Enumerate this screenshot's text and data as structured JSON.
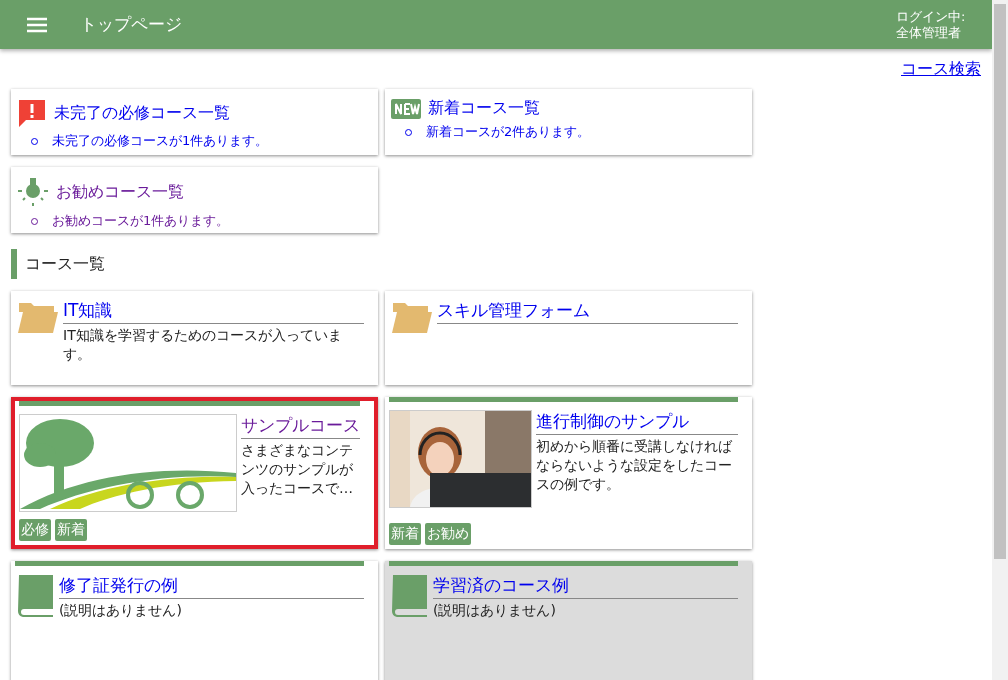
{
  "header": {
    "title": "トップページ",
    "login_label": "ログイン中:",
    "user": "全体管理者"
  },
  "search_link": "コース検索",
  "notices": [
    {
      "kind": "alert",
      "title": "未完了の必修コース一覧",
      "item": "未完了の必修コースが1件あります。",
      "visited": false
    },
    {
      "kind": "new",
      "title": "新着コース一覧",
      "item": "新着コースが2件あります。",
      "visited": false
    },
    {
      "kind": "recommend",
      "title": "お勧めコース一覧",
      "item": "お勧めコースが1件あります。",
      "visited": true
    }
  ],
  "section_title": "コース一覧",
  "courses": [
    {
      "kind": "folder",
      "title": "IT知識",
      "description": "IT知識を学習するためのコースが入っています。",
      "visited": false,
      "highlighted": false,
      "completed": false
    },
    {
      "kind": "folder",
      "title": "スキル管理フォーム",
      "visited": false,
      "highlighted": false,
      "completed": false
    },
    {
      "kind": "picture",
      "title": "サンプルコース",
      "description": "さまざまなコンテンツのサンプルが入ったコースで…",
      "tags": [
        "必修",
        "新着"
      ],
      "visited": true,
      "highlighted": true,
      "completed": false
    },
    {
      "kind": "picture",
      "title": "進行制御のサンプル",
      "description": "初めから順番に受講しなければならないような設定をしたコースの例です。",
      "tags": [
        "新着",
        "お勧め"
      ],
      "visited": false,
      "highlighted": false,
      "completed": false
    },
    {
      "kind": "book",
      "title": "修了証発行の例",
      "description": "(説明はありません)",
      "visited": false,
      "highlighted": false,
      "completed": false
    },
    {
      "kind": "book",
      "title": "学習済のコース例",
      "description": "(説明はありません)",
      "visited": false,
      "highlighted": false,
      "completed": true
    }
  ]
}
